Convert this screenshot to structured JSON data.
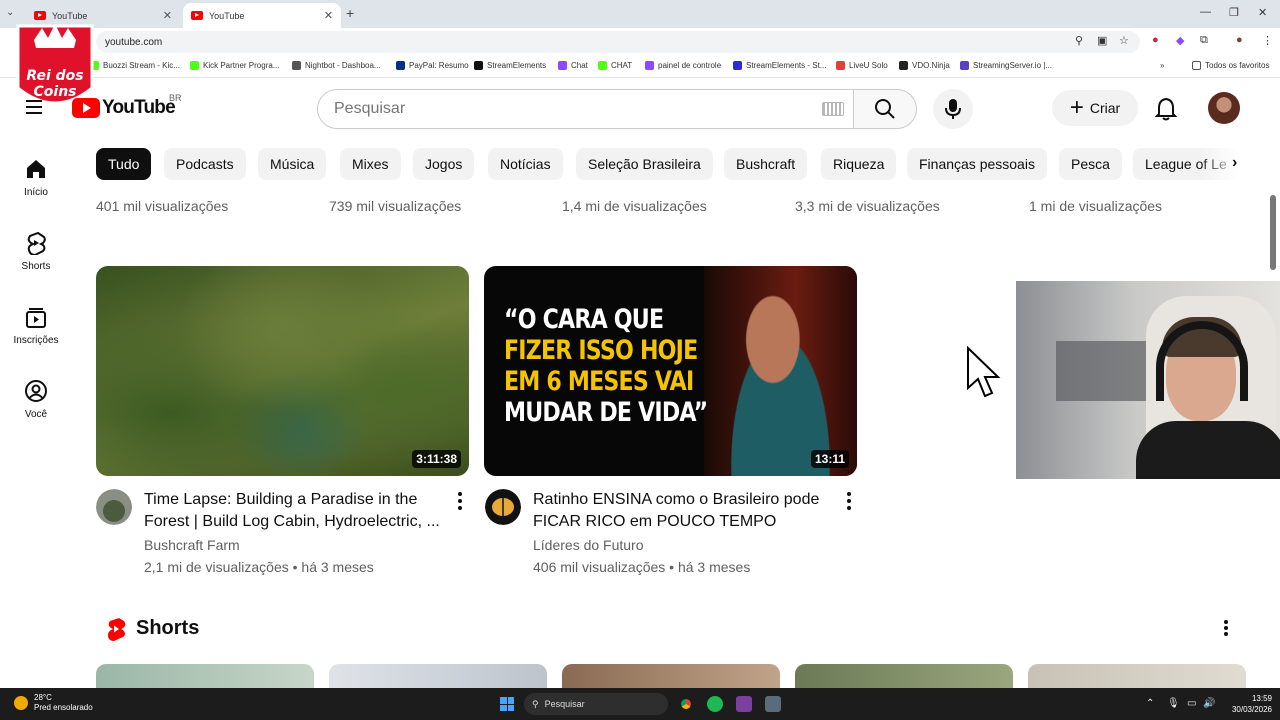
{
  "browser": {
    "tabs": [
      {
        "title": "YouTube",
        "active": false
      },
      {
        "title": "YouTube",
        "active": true
      }
    ],
    "url": "youtube.com",
    "bookmarks": [
      {
        "label": "Buozzi Stream - Kic...",
        "color": "#53fc18"
      },
      {
        "label": "Kick Partner Progra...",
        "color": "#53fc18"
      },
      {
        "label": "Nightbot - Dashboa...",
        "color": "#555555"
      },
      {
        "label": "PayPal: Resumo",
        "color": "#003087"
      },
      {
        "label": "StreamElements",
        "color": "#111111"
      },
      {
        "label": "Chat",
        "color": "#9146ff"
      },
      {
        "label": "CHAT",
        "color": "#53fc18"
      },
      {
        "label": "painel de controle",
        "color": "#9146ff"
      },
      {
        "label": "StreamElements - St...",
        "color": "#2b2bcf"
      },
      {
        "label": "LiveU Solo",
        "color": "#e0403a"
      },
      {
        "label": "VDO.Ninja",
        "color": "#222222"
      },
      {
        "label": "StreamingServer.io |...",
        "color": "#5a3fc0"
      }
    ],
    "all_bookmarks": "Todos os favoritos"
  },
  "overlay_logo": {
    "line1": "Rei dos",
    "line2": "Coins"
  },
  "header": {
    "logo": "YouTube",
    "country": "BR",
    "search_placeholder": "Pesquisar",
    "create_label": "Criar"
  },
  "sidebar": [
    {
      "label": "Início",
      "icon": "home-icon"
    },
    {
      "label": "Shorts",
      "icon": "shorts-icon"
    },
    {
      "label": "Inscrições",
      "icon": "subscriptions-icon"
    },
    {
      "label": "Você",
      "icon": "you-icon"
    }
  ],
  "chips": [
    "Tudo",
    "Podcasts",
    "Música",
    "Mixes",
    "Jogos",
    "Notícias",
    "Seleção Brasileira",
    "Bushcraft",
    "Riqueza",
    "Finanças pessoais",
    "Pesca",
    "League of Le"
  ],
  "previous_row_views": [
    "401 mil visualizações",
    "739 mil visualizações",
    "1,4 mi de visualizações",
    "3,3 mi de visualizações",
    "1 mi de visualizações"
  ],
  "videos": [
    {
      "title": "Time Lapse: Building a Paradise in the Forest | Build Log Cabin, Hydroelectric, ...",
      "channel": "Bushcraft Farm",
      "views": "2,1 mi de visualizações",
      "age": "há 3 meses",
      "meta": "2,1 mi de visualizações • há 3 meses",
      "duration": "3:11:38"
    },
    {
      "title": "Ratinho ENSINA como o Brasileiro pode FICAR RICO em POUCO TEMPO",
      "channel": "Líderes do Futuro",
      "views": "406 mil visualizações",
      "age": "há 3 meses",
      "meta": "406 mil visualizações • há 3 meses",
      "duration": "13:11",
      "thumbnail_text": {
        "line1": "“O CARA QUE",
        "line2": "FIZER ISSO HOJE",
        "line3": "EM 6 MESES VAI",
        "line4": "MUDAR DE VIDA”"
      }
    }
  ],
  "shorts_section": {
    "title": "Shorts"
  },
  "taskbar": {
    "temperature": "28°C",
    "weather": "Pred ensolarado",
    "search": "Pesquisar",
    "time": "13:59",
    "date": "30/03/2026"
  },
  "colors": {
    "youtube_red": "#ff0000",
    "chip_selected": "#0f0f0f",
    "chip_bg": "#f2f2f2",
    "secondary_text": "#606060"
  }
}
